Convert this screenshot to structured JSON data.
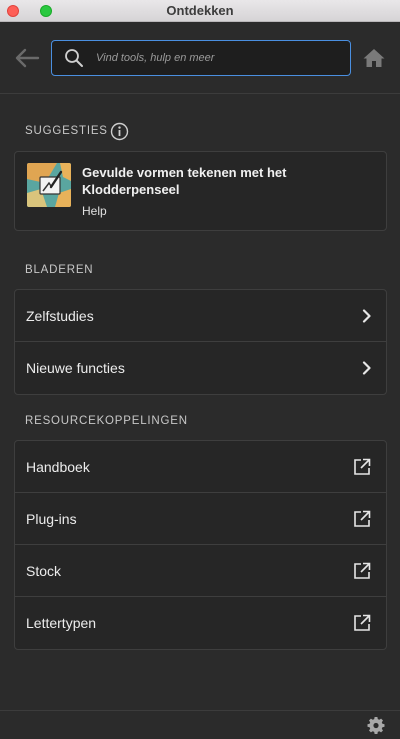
{
  "window": {
    "title": "Ontdekken"
  },
  "search": {
    "placeholder": "Vind tools, hulp en meer"
  },
  "suggestions": {
    "heading": "SUGGESTIES",
    "item": {
      "title": "Gevulde vormen tekenen met het Klodderpenseel",
      "subtitle": "Help"
    }
  },
  "browse": {
    "heading": "BLADEREN",
    "items": [
      {
        "label": "Zelfstudies"
      },
      {
        "label": "Nieuwe functies"
      }
    ]
  },
  "resources": {
    "heading": "RESOURCEKOPPELINGEN",
    "items": [
      {
        "label": "Handboek"
      },
      {
        "label": "Plug-ins"
      },
      {
        "label": "Stock"
      },
      {
        "label": "Lettertypen"
      }
    ]
  },
  "icons": {
    "back": "arrow-left-icon",
    "search": "search-icon",
    "home": "home-icon",
    "info": "info-icon",
    "chevron": "chevron-right-icon",
    "external": "external-link-icon",
    "settings": "gear-icon"
  },
  "colors": {
    "accent": "#4a8fe0",
    "background": "#2b2b2b",
    "card": "#262626"
  }
}
